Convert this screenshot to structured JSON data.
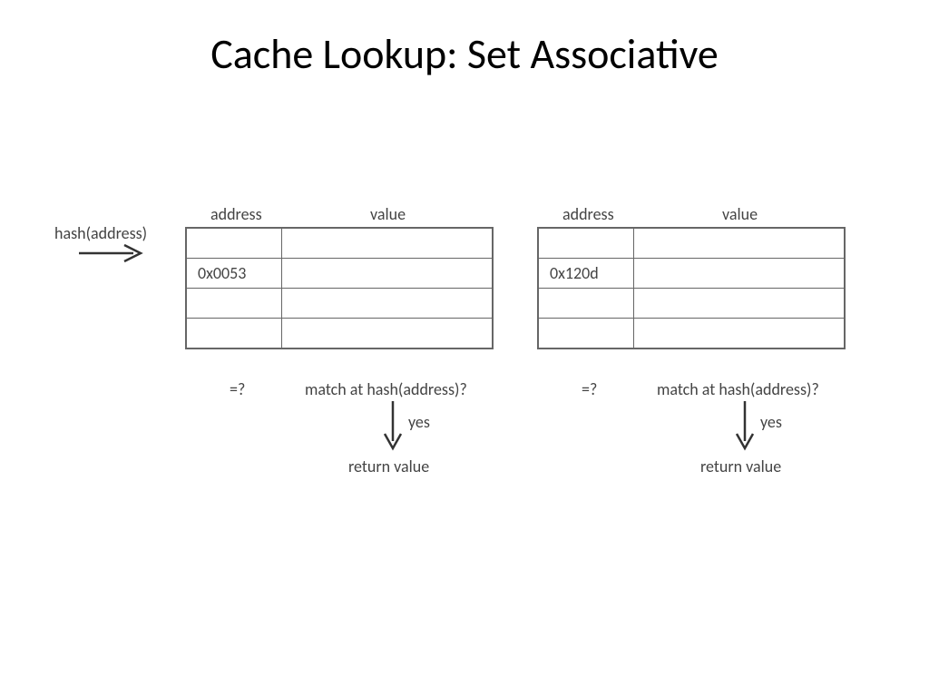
{
  "title": "Cache Lookup: Set Associative",
  "labels": {
    "hash": "hash(address)",
    "address": "address",
    "value": "value",
    "eq": "=?",
    "match": "match at hash(address)?",
    "yes": "yes",
    "ret": "return value"
  },
  "tables": [
    {
      "rows": [
        {
          "address": "",
          "value": ""
        },
        {
          "address": "0x0053",
          "value": ""
        },
        {
          "address": "",
          "value": ""
        },
        {
          "address": "",
          "value": ""
        }
      ]
    },
    {
      "rows": [
        {
          "address": "",
          "value": ""
        },
        {
          "address": "0x120d",
          "value": ""
        },
        {
          "address": "",
          "value": ""
        },
        {
          "address": "",
          "value": ""
        }
      ]
    }
  ]
}
